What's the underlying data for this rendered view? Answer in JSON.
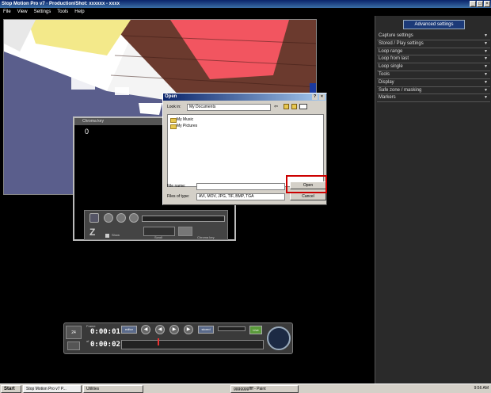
{
  "window": {
    "title": "Stop Motion Pro v7 · Production/Shot: xxxxxx - xxxx"
  },
  "menu": [
    "File",
    "View",
    "Settings",
    "Tools",
    "Help"
  ],
  "right_panel": {
    "advanced_label": "Advanced settings",
    "rows": [
      "Capture settings",
      "Stored / Play settings",
      "Loop range",
      "Loop from last",
      "Loop single",
      "Tools",
      "Display",
      "Safe zone / masking",
      "Markers"
    ]
  },
  "chroma": {
    "title": "Chroma key",
    "number": "0",
    "show_label": "Show",
    "scroll_label": "Scroll",
    "chroma_label": "Chroma key"
  },
  "open_dialog": {
    "title": "Open",
    "look_in_label": "Look in:",
    "look_in_value": "My Documents",
    "items": [
      "My Music",
      "My Pictures"
    ],
    "file_name_label": "File name:",
    "file_name_value": "",
    "files_type_label": "Files of type:",
    "files_type_value": "AVI, MOV, JPG, TIF, BMP, TGA",
    "open_label": "Open",
    "cancel_label": "Cancel"
  },
  "transport": {
    "frame_label": "Frame",
    "time1": "0:00:01",
    "of_label": "of",
    "time2": "0:00:02",
    "fps": "24",
    "edit_label": "editor",
    "stored_label": "stored",
    "live_label": "Live"
  },
  "taskbar": {
    "start": "Start",
    "tasks": [
      "Stop Motion Pro v7  P...",
      "Utilities",
      "gggggggffff - Paint"
    ],
    "clock": "9:56 AM"
  }
}
